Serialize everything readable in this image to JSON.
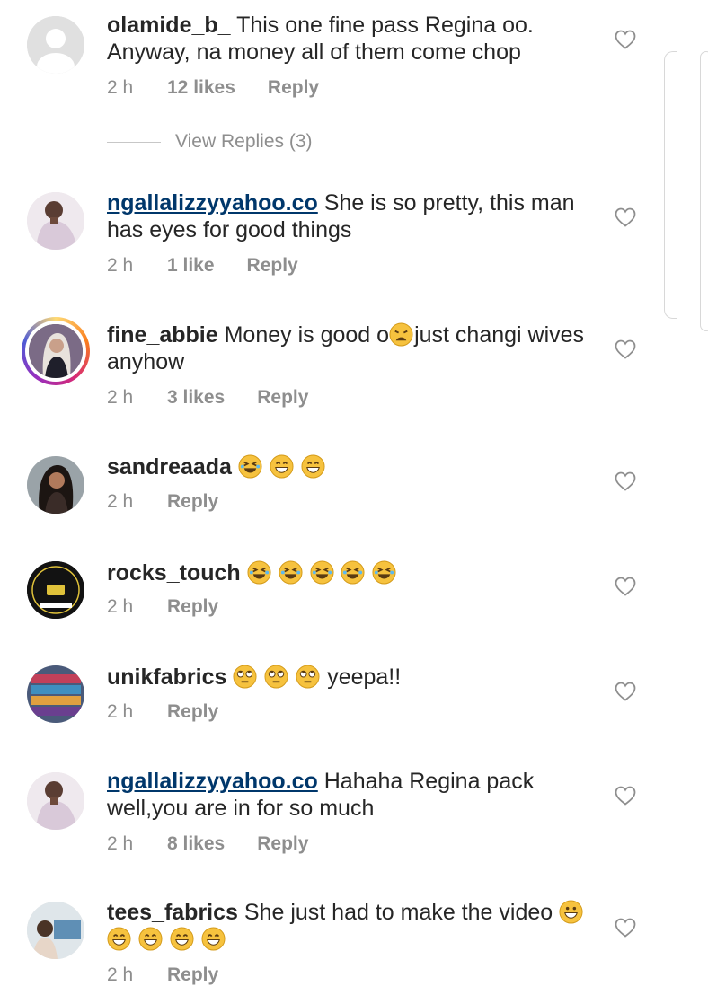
{
  "comments": [
    {
      "id": "c1",
      "user": "olamide_b_",
      "text": "This one fine pass Regina oo. Anyway, na money all of them come chop",
      "time": "2 h",
      "likes": "12 likes",
      "reply": "Reply",
      "avatar": "default-avatar"
    },
    {
      "id": "c2",
      "user": "ngallalizzyyahoo.co",
      "text": "She is so pretty, this man has eyes for good things",
      "time": "2 h",
      "likes": "1 like",
      "reply": "Reply",
      "avatar": "photo"
    },
    {
      "id": "c3",
      "user": "fine_abbie",
      "text_before": "Money is good o",
      "text_after": "just changi wives anyhow",
      "time": "2 h",
      "likes": "3 likes",
      "reply": "Reply",
      "avatar": "story-ring"
    },
    {
      "id": "c4",
      "user": "sandreaada",
      "time": "2 h",
      "reply": "Reply",
      "avatar": "photo"
    },
    {
      "id": "c5",
      "user": "rocks_touch",
      "time": "2 h",
      "reply": "Reply",
      "avatar": "logo"
    },
    {
      "id": "c6",
      "user": "unikfabrics",
      "text_after": "yeepa!!",
      "time": "2 h",
      "reply": "Reply",
      "avatar": "photo"
    },
    {
      "id": "c7",
      "user": "ngallalizzyyahoo.co",
      "text": "Hahaha Regina pack well,you are in for so much",
      "time": "2 h",
      "likes": "8 likes",
      "reply": "Reply",
      "avatar": "photo"
    },
    {
      "id": "c8",
      "user": "tees_fabrics",
      "text": "She just had to make the video",
      "time": "2 h",
      "reply": "Reply",
      "avatar": "photo"
    }
  ],
  "view_replies": "View Replies (3)",
  "colors": {
    "text": "#262626",
    "meta": "#8e8e8e",
    "link": "#00376b",
    "emoji": "#f6c23e"
  },
  "icons": {
    "heart": "heart-outline-icon",
    "emoji_laugh": "rofl-emoji",
    "emoji_grin": "grinning-emoji",
    "emoji_roll": "eye-roll-emoji",
    "emoji_weary": "weary-emoji"
  }
}
